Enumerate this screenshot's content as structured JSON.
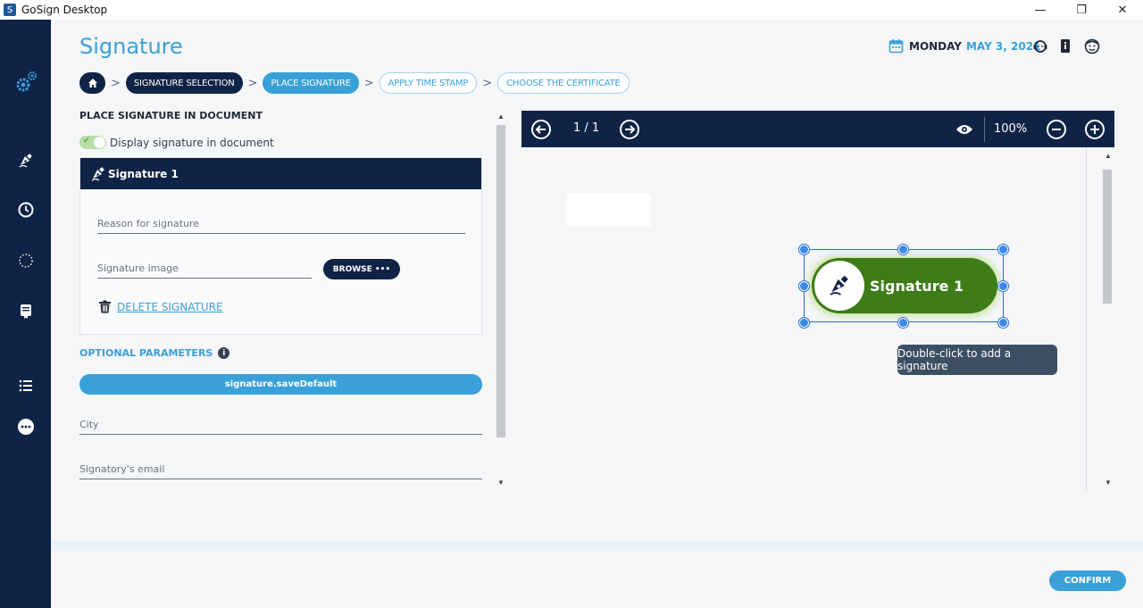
{
  "window": {
    "title": "GoSign Desktop",
    "app_icon_letter": "S",
    "controls": {
      "minimize": "—",
      "maximize": "❐",
      "close": "✕"
    }
  },
  "sidebar": {
    "items": [
      {
        "name": "settings",
        "icon": "gears-icon"
      },
      {
        "name": "sign",
        "icon": "pen-sign-icon"
      },
      {
        "name": "history",
        "icon": "clock-icon"
      },
      {
        "name": "processing",
        "icon": "dotted-circle-icon"
      },
      {
        "name": "documents",
        "icon": "certificate-icon"
      },
      {
        "name": "list",
        "icon": "list-icon"
      },
      {
        "name": "more",
        "icon": "more-icon"
      }
    ]
  },
  "header": {
    "title": "Signature",
    "date_day": "MONDAY",
    "date_rest": "MAY 3, 2021",
    "icons": [
      "calendar-icon",
      "support-icon",
      "manual-icon",
      "user-icon"
    ]
  },
  "steps": {
    "home_icon": "home-icon",
    "items": [
      {
        "label": "SIGNATURE SELECTION",
        "state": "done"
      },
      {
        "label": "PLACE SIGNATURE",
        "state": "active"
      },
      {
        "label": "APPLY TIME STAMP",
        "state": "pending"
      },
      {
        "label": "CHOOSE THE CERTIFICATE",
        "state": "pending"
      }
    ],
    "separator": ">"
  },
  "left_panel": {
    "section_title": "PLACE SIGNATURE IN DOCUMENT",
    "toggle_label": "Display signature in document",
    "toggle_on": true,
    "signature_card": {
      "title": "Signature 1",
      "reason_placeholder": "Reason for signature",
      "image_placeholder": "Signature image",
      "browse_label": "BROWSE •••",
      "delete_label": "DELETE SIGNATURE"
    },
    "optional_title": "OPTIONAL PARAMETERS",
    "info_glyph": "i",
    "save_default_label": "signature.saveDefault",
    "city_placeholder": "City",
    "email_placeholder": "Signatory's email"
  },
  "viewer": {
    "page_indicator": "1 / 1",
    "zoom": "100%",
    "signature_label": "Signature 1",
    "tooltip": "Double-click to add a signature"
  },
  "footer": {
    "confirm_label": "CONFIRM"
  },
  "colors": {
    "navy": "#0f2346",
    "accent": "#3aa0d8",
    "signature_green": "#3e7c17"
  }
}
